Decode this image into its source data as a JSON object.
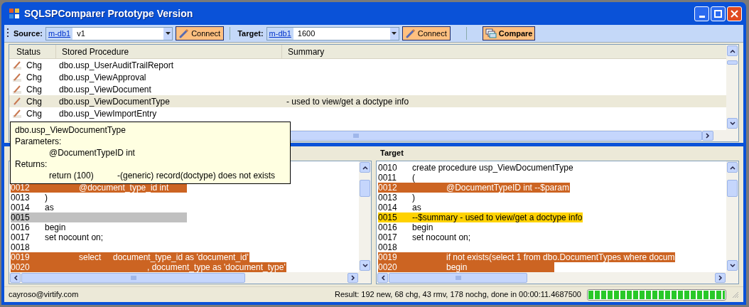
{
  "window": {
    "title": "SQLSPComparer Prototype Version"
  },
  "toolbar": {
    "source": {
      "label": "Source:",
      "server": "m-db1",
      "database": "v1",
      "button": "Connect"
    },
    "target": {
      "label": "Target:",
      "server": "m-db1",
      "database": "1600",
      "button": "Connect"
    },
    "compare_button": "Compare"
  },
  "procedures": {
    "columns": [
      "Status",
      "Stored Procedure",
      "Summary"
    ],
    "rows": [
      {
        "status": "Chg",
        "name": "dbo.usp_UserAuditTrailReport",
        "selected": false
      },
      {
        "status": "Chg",
        "name": "dbo.usp_ViewApproval",
        "selected": false
      },
      {
        "status": "Chg",
        "name": "dbo.usp_ViewDocument",
        "selected": false
      },
      {
        "status": "Chg",
        "name": "dbo.usp_ViewDocumentType",
        "summary": "- used to view/get a doctype info",
        "selected": true
      },
      {
        "status": "Chg",
        "name": "dbo.usp_ViewImportEntry",
        "selected": false
      }
    ]
  },
  "tooltip": {
    "title": "dbo.usp_ViewDocumentType",
    "lines": [
      "Parameters:",
      "\t@DocumentTypeID int",
      "Returns:",
      "\treturn (100)\t-(generic) record(doctype) does not exists"
    ]
  },
  "source_pane": {
    "lines": [
      {
        "number": "0012",
        "text": "\t@document_type_id int",
        "kind": "changed"
      },
      {
        "number": "0013",
        "text": ")",
        "kind": "same"
      },
      {
        "number": "0014",
        "text": "as",
        "kind": "same"
      },
      {
        "number": "0015",
        "kind": "missing"
      },
      {
        "number": "0016",
        "text": "begin",
        "kind": "same"
      },
      {
        "number": "0017",
        "text": "set nocount on;",
        "kind": "same"
      },
      {
        "number": "0018",
        "kind": "same"
      },
      {
        "number": "0019",
        "text": "\tselect\tdocument_type_id as 'document_id'",
        "kind": "changed"
      },
      {
        "number": "0020",
        "text": "\t\t\t, document_type as 'document_type'",
        "kind": "changed"
      }
    ]
  },
  "target_pane": {
    "header": "Target",
    "lines": [
      {
        "number": "0010",
        "text": "create procedure usp_ViewDocumentType",
        "kind": "same"
      },
      {
        "number": "0011",
        "text": "(",
        "kind": "same"
      },
      {
        "number": "0012",
        "text": "\t@DocumentTypeID int --$param",
        "kind": "changed"
      },
      {
        "number": "0013",
        "text": ")",
        "kind": "same"
      },
      {
        "number": "0014",
        "text": "as",
        "kind": "same"
      },
      {
        "number": "0015",
        "text": "--$summary - used to view/get a doctype info",
        "kind": "summary"
      },
      {
        "number": "0016",
        "text": "begin",
        "kind": "same"
      },
      {
        "number": "0017",
        "text": "set nocount on;",
        "kind": "same"
      },
      {
        "number": "0018",
        "kind": "same"
      },
      {
        "number": "0019",
        "text": "\tif not exists(select 1 from dbo.DocumentTypes where docum",
        "kind": "changed"
      },
      {
        "number": "0020",
        "text": "\tbegin",
        "kind": "changed"
      }
    ]
  },
  "status_bar": {
    "user": "cayroso@virtify.com",
    "result": "Result: 192 new, 68 chg, 43 rmv, 178 nochg, done in 00:00:11.4687500",
    "progress": {
      "level": 1
    }
  }
}
